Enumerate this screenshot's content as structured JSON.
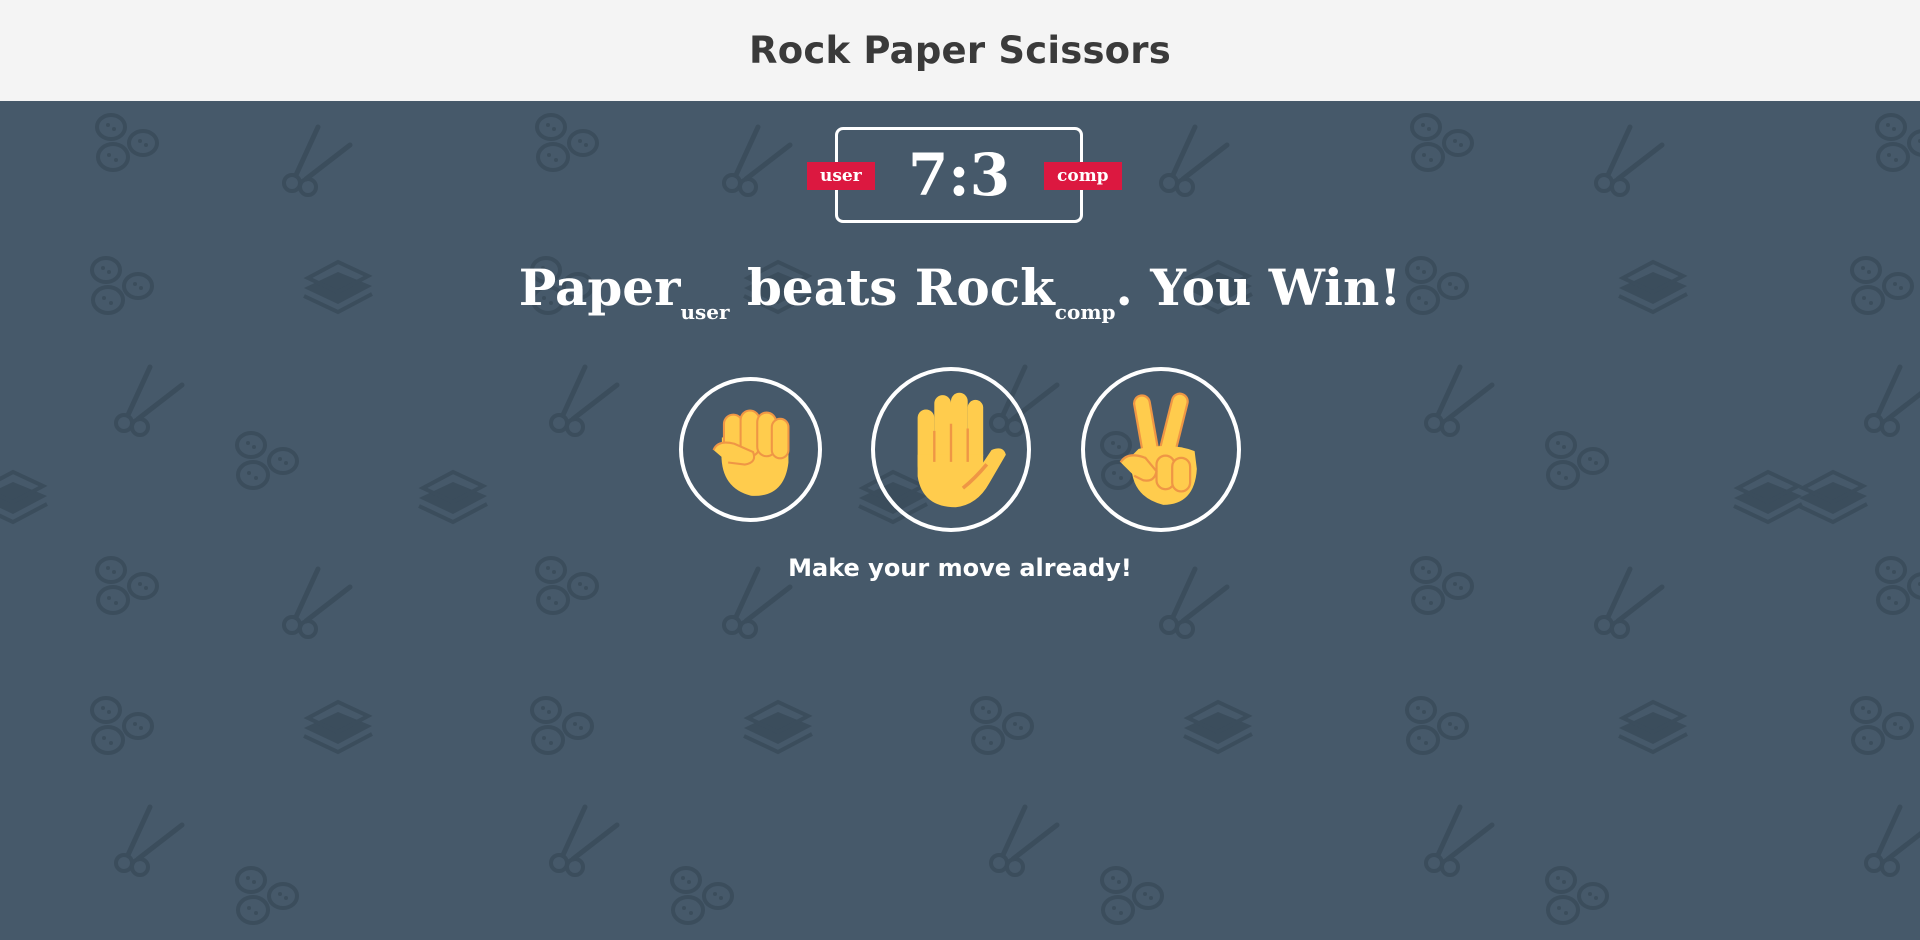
{
  "header": {
    "title": "Rock Paper Scissors"
  },
  "scoreboard": {
    "score": "7:3",
    "user_label": "user",
    "comp_label": "comp"
  },
  "result": {
    "user_move": "Paper",
    "user_sub": "user",
    "verb": "beats",
    "comp_move": "Rock",
    "comp_sub": "comp",
    "outcome": ". You Win!"
  },
  "choices": [
    {
      "name": "rock",
      "icon": "raised-fist-icon"
    },
    {
      "name": "paper",
      "icon": "raised-hand-icon"
    },
    {
      "name": "scissors",
      "icon": "victory-hand-icon"
    }
  ],
  "prompt": "Make your move already!",
  "colors": {
    "header_bg": "#f4f4f4",
    "board_bg": "#46596a",
    "badge": "#dc1840",
    "emoji_yellow": "#ffcc4d",
    "emoji_shade": "#ef9645",
    "pattern": "#3b4d5c"
  }
}
